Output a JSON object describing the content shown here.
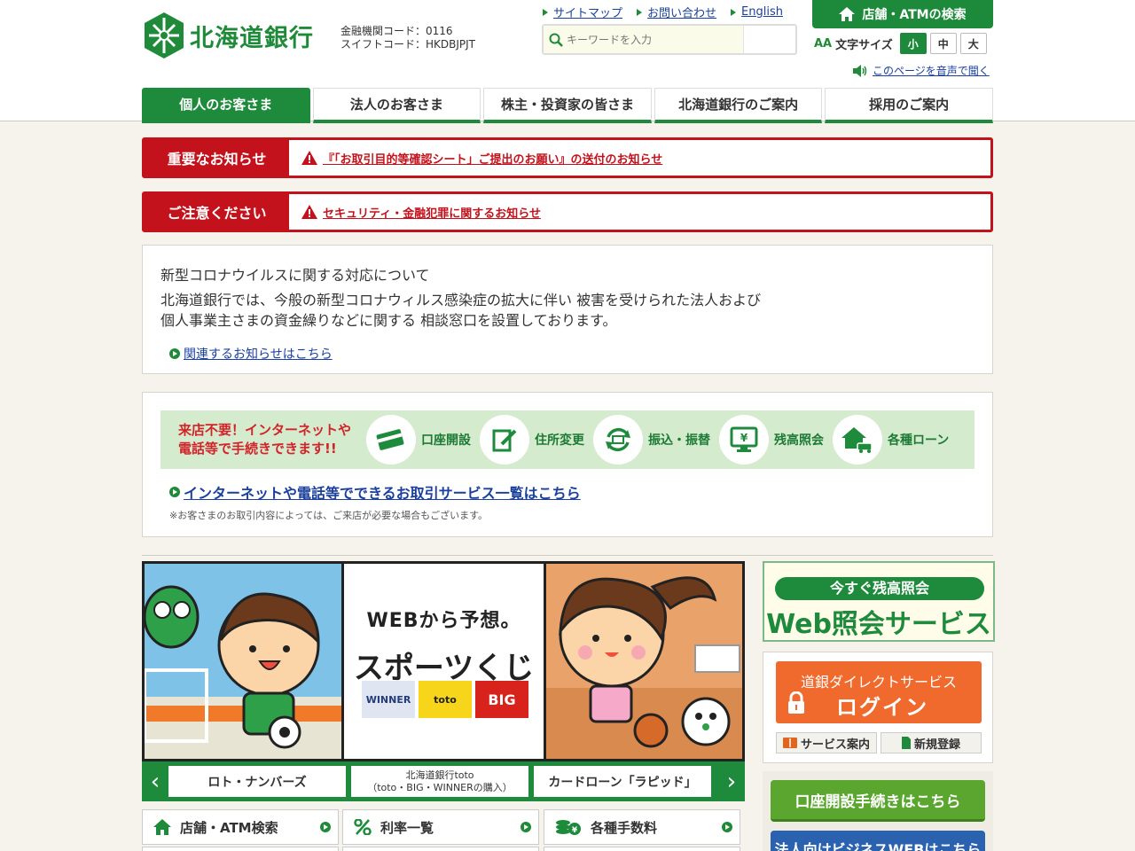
{
  "brand": {
    "name": "北海道銀行",
    "color": "#1e8a3c"
  },
  "codes": {
    "bank_code": "金融機関コード：0116",
    "swift_code": "スイフトコード：HKDBJPJT"
  },
  "top_links": [
    {
      "label": "サイトマップ"
    },
    {
      "label": "お問い合わせ"
    },
    {
      "label": "English"
    }
  ],
  "search": {
    "placeholder": "キーワードを入力"
  },
  "atm_button": {
    "label": "店舗・ATMの検索",
    "icon": "home-icon"
  },
  "font_size": {
    "label": "文字サイズ",
    "a_glyph": "AA",
    "options": [
      "小",
      "中",
      "大"
    ],
    "selected": "小"
  },
  "voice": {
    "label": "このページを音声で聞く",
    "icon": "speaker-icon"
  },
  "nav": [
    {
      "label": "個人のお客さま",
      "active": true
    },
    {
      "label": "法人のお客さま"
    },
    {
      "label": "株主・投資家の皆さま"
    },
    {
      "label": "北海道銀行のご案内"
    },
    {
      "label": "採用のご案内"
    }
  ],
  "notices": [
    {
      "label": "重要なお知らせ",
      "link": "『「お取引目的等確認シート」ご提出のお願い』の送付のお知らせ",
      "icon": "warning-icon"
    },
    {
      "label": "ご注意ください",
      "link": "セキュリティ・金融犯罪に関するお知らせ",
      "icon": "warning-icon"
    }
  ],
  "corona": {
    "title": "新型コロナウイルスに関する対応について",
    "line1": "北海道銀行では、今般の新型コロナウィルス感染症の拡大に伴い 被害を受けられた法人および",
    "line2": "個人事業主さまの資金繰りなどに関する 相談窓口を設置しております。",
    "link": "関連するお知らせはこちら"
  },
  "services": {
    "tag_line1": "来店不要！インターネットや",
    "tag_line2": "電話等で手続きできます!!",
    "items": [
      {
        "label": "口座開設",
        "icon": "card-icon"
      },
      {
        "label": "住所変更",
        "icon": "edit-icon"
      },
      {
        "label": "振込・振替",
        "icon": "transfer-icon"
      },
      {
        "label": "残高照会",
        "icon": "balance-monitor-icon"
      },
      {
        "label": "各種ローン",
        "icon": "house-car-icon"
      }
    ],
    "link": "インターネットや電話等でできるお取引サービス一覧はこちら",
    "note": "※お客さまのお取引内容によっては、ご来店が必要な場合もございます。"
  },
  "banner": {
    "subtitle": "WEBから予想。",
    "title": "スポーツくじ",
    "logos": [
      "WINNER",
      "toto",
      "BIG"
    ]
  },
  "carousel": {
    "items": [
      {
        "label": "ロト・ナンバーズ"
      },
      {
        "line1": "北海道銀行toto",
        "line2": "（toto・BIG・WINNERの購入）"
      },
      {
        "label": "カードローン「ラピッド」"
      }
    ],
    "prev": "‹",
    "next": "›"
  },
  "quick_links": [
    {
      "label": "店舗・ATM検索",
      "icon": "home-icon"
    },
    {
      "label": "利率一覧",
      "icon": "percent-icon"
    },
    {
      "label": "各種手数料",
      "icon": "coins-icon"
    }
  ],
  "web_inquiry": {
    "pill": "今すぐ残高照会",
    "title": "Web照会サービス"
  },
  "direct": {
    "sub": "道銀ダイレクトサービス",
    "main": "ログイン",
    "guide": "サービス案内",
    "register": "新規登録"
  },
  "account_button": "口座開設手続きはこちら",
  "business_button": "法人向けビジネスWEBはこちら"
}
